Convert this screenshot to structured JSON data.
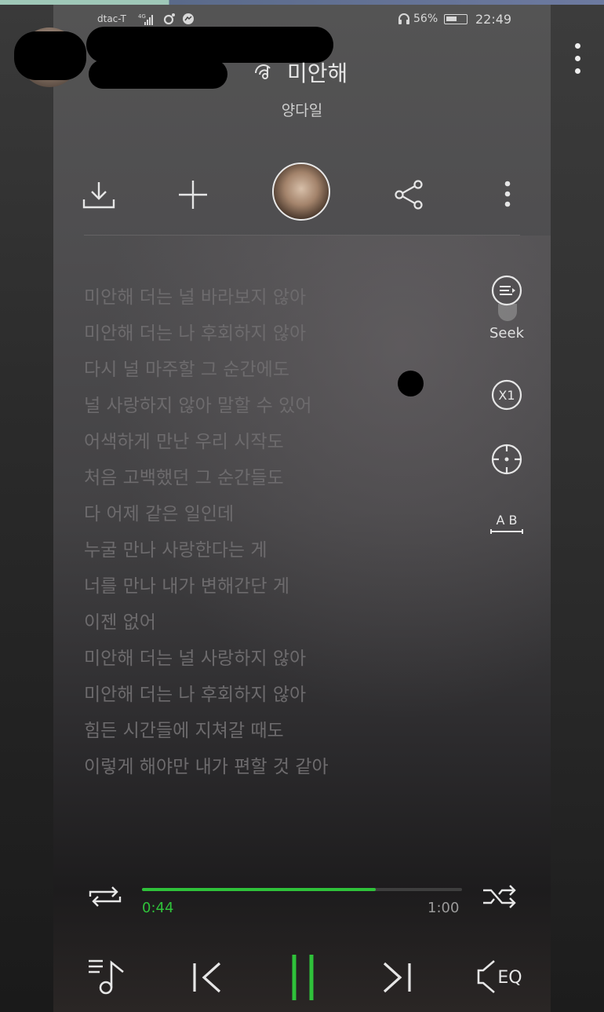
{
  "status_bar": {
    "carrier": "dtac-T",
    "network": "4G",
    "battery": "56%",
    "time": "22:49"
  },
  "now_playing": {
    "title": "미안해",
    "artist": "양다일"
  },
  "lyrics": [
    "미안해 더는 널 바라보지 않아",
    "미안해 더는 나 후회하지 않아",
    "다시 널 마주할 그 순간에도",
    "널 사랑하지 않아 말할 수 있어",
    "어색하게 만난 우리 시작도",
    "처음 고백했던 그 순간들도",
    "다 어제 같은 일인데",
    "누굴 만나 사랑한다는 게",
    "너를 만나 내가 변해간단 게",
    "이젠 없어",
    "미안해 더는 널 사랑하지 않아",
    "미안해 더는 나 후회하지 않아",
    "힘든 시간들에 지쳐갈 때도",
    "이렇게 해야만 내가 편할 것 같아"
  ],
  "side_controls": {
    "seek_label": "Seek",
    "speed_label": "X1",
    "ab_label": "A B"
  },
  "player": {
    "current_time": "0:44",
    "total_time": "1:00",
    "progress": 0.73,
    "eq_label": "EQ"
  },
  "colors": {
    "accent": "#2fc23a",
    "lyric_text": "#6d6b6d"
  },
  "icons": [
    "download-icon",
    "add-icon",
    "share-icon",
    "more-icon",
    "lyrics-sync-icon",
    "speed-icon",
    "target-icon",
    "ab-repeat-icon",
    "repeat-icon",
    "shuffle-icon",
    "playlist-icon",
    "previous-icon",
    "pause-icon",
    "next-icon",
    "equalizer-icon"
  ]
}
